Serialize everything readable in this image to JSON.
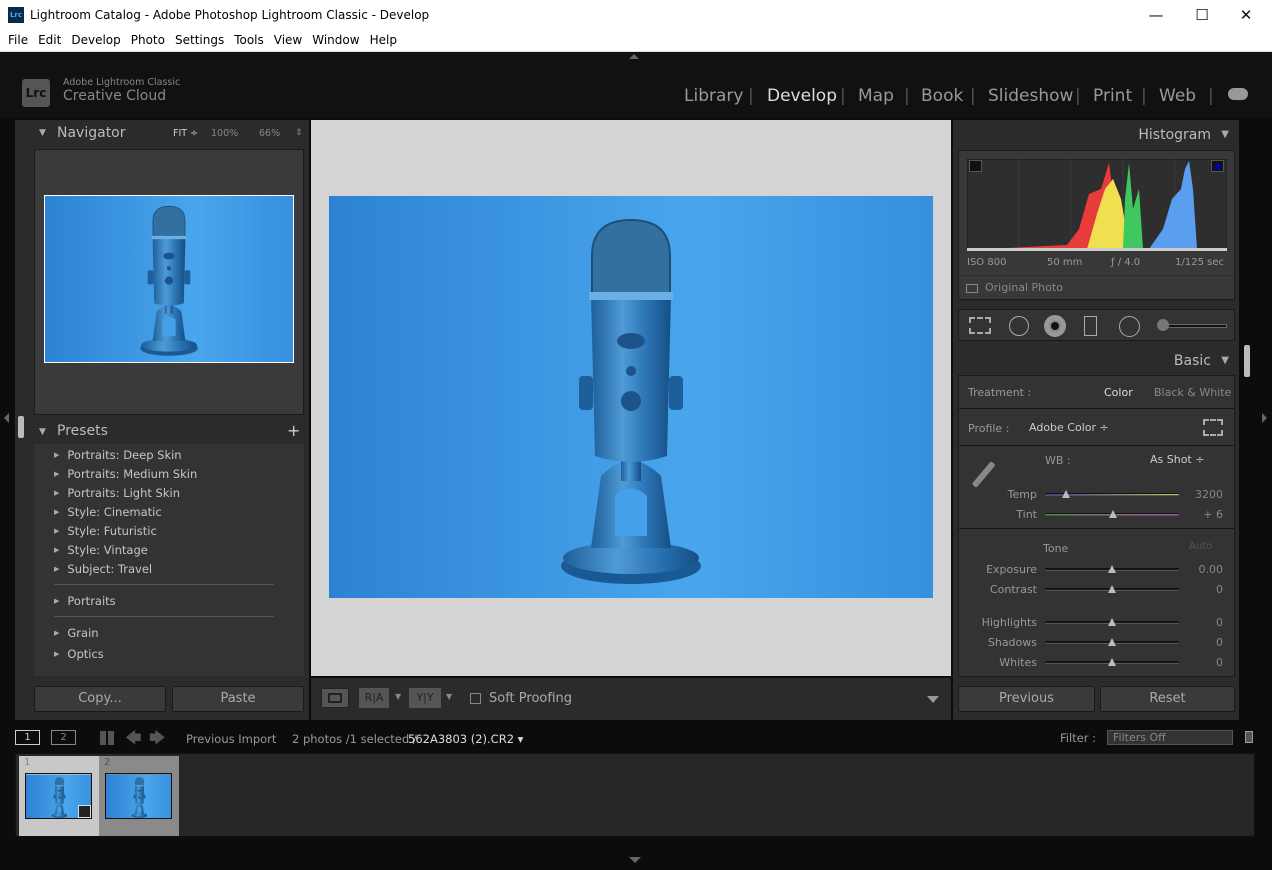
{
  "window": {
    "title": "Lightroom Catalog - Adobe Photoshop Lightroom Classic - Develop",
    "app_icon": "Lrc",
    "minimize": "—",
    "maximize": "☐",
    "close": "✕"
  },
  "menu": [
    "File",
    "Edit",
    "Develop",
    "Photo",
    "Settings",
    "Tools",
    "View",
    "Window",
    "Help"
  ],
  "brand": {
    "logo": "Lrc",
    "line1": "Adobe Lightroom Classic",
    "line2": "Creative Cloud"
  },
  "modules": [
    {
      "label": "Library",
      "active": false
    },
    {
      "label": "Develop",
      "active": true
    },
    {
      "label": "Map",
      "active": false
    },
    {
      "label": "Book",
      "active": false
    },
    {
      "label": "Slideshow",
      "active": false
    },
    {
      "label": "Print",
      "active": false
    },
    {
      "label": "Web",
      "active": false
    }
  ],
  "navigator": {
    "title": "Navigator",
    "zoom_options": [
      "FIT ÷",
      "100%",
      "66%"
    ]
  },
  "presets": {
    "title": "Presets",
    "add": "+",
    "items": [
      "Portraits: Deep Skin",
      "Portraits: Medium Skin",
      "Portraits: Light Skin",
      "Style: Cinematic",
      "Style: Futuristic",
      "Style: Vintage",
      "Subject: Travel"
    ],
    "groups": [
      "Portraits",
      "Grain",
      "Optics"
    ]
  },
  "left_buttons": {
    "copy": "Copy...",
    "paste": "Paste"
  },
  "toolbar": {
    "ra": "R|A",
    "yy": "Y|Y",
    "soft_proofing": "Soft Proofing"
  },
  "histogram": {
    "title": "Histogram",
    "iso": "ISO 800",
    "focal": "50 mm",
    "aperture": "ƒ / 4.0",
    "shutter": "1/125 sec",
    "original_photo": "Original Photo",
    "colors": {
      "red": "#e83c3c",
      "yellow": "#f0e050",
      "green": "#40c860",
      "blue": "#5a9ef0"
    }
  },
  "basic": {
    "title": "Basic",
    "treatment_label": "Treatment :",
    "color": "Color",
    "bw": "Black & White",
    "profile_label": "Profile :",
    "profile": "Adobe Color ÷",
    "wb_label": "WB :",
    "wb": "As Shot ÷",
    "tone": "Tone",
    "auto": "Auto",
    "sliders": [
      {
        "label": "Temp",
        "value": "3200",
        "pos": 0.16
      },
      {
        "label": "Tint",
        "value": "+ 6",
        "pos": 0.51
      },
      {
        "label": "Exposure",
        "value": "0.00",
        "pos": 0.5
      },
      {
        "label": "Contrast",
        "value": "0",
        "pos": 0.5
      },
      {
        "label": "Highlights",
        "value": "0",
        "pos": 0.5
      },
      {
        "label": "Shadows",
        "value": "0",
        "pos": 0.5
      },
      {
        "label": "Whites",
        "value": "0",
        "pos": 0.5
      }
    ]
  },
  "right_buttons": {
    "previous": "Previous",
    "reset": "Reset"
  },
  "filmstrip": {
    "view1": "1",
    "view2": "2",
    "source": "Previous Import",
    "count": "2 photos /1 selected /",
    "filename": "562A3803 (2).CR2 ▾",
    "filter_label": "Filter :",
    "filter": "Filters Off",
    "thumbs": [
      "1",
      "2"
    ]
  }
}
